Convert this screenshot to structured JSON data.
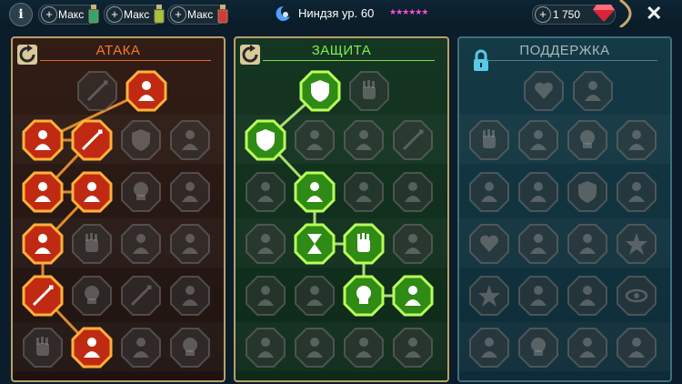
{
  "topbar": {
    "info_icon": "info-icon",
    "boosts": [
      {
        "label": "Макс",
        "icon": "potion-icon",
        "color": "#2fa86a"
      },
      {
        "label": "Макс",
        "icon": "potion-icon",
        "color": "#a6c43a"
      },
      {
        "label": "Макс",
        "icon": "potion-icon",
        "color": "#d43a3a"
      }
    ],
    "hero_name": "Ниндзя ур. 60",
    "hero_icon": "ninja-emblem-icon",
    "stars": "★★★★★★",
    "gems": "1 750",
    "gem_icon": "ruby-icon",
    "close_icon": "close-icon"
  },
  "panels": {
    "attack": {
      "title": "АТАКА",
      "reset_icon": "reset-icon",
      "accent": "#e8632a",
      "nodes": [
        [
          "sword-icon",
          "claws-icon",
          "",
          ""
        ],
        [
          "demon-icon",
          "blades-icon",
          "shield-icon",
          "mask-icon"
        ],
        [
          "hurt-icon",
          "fangs-icon",
          "skull-icon",
          "axe-icon"
        ],
        [
          "blast-icon",
          "fist-icon",
          "hammer-icon",
          "wings-icon"
        ],
        [
          "crossed-sword-icon",
          "skull-icon",
          "spear-icon",
          "warrior-icon"
        ],
        [
          "fist-icon",
          "helm-icon",
          "spirits-icon",
          "skull-icon"
        ]
      ],
      "active": [
        [
          0,
          1
        ],
        [
          1,
          0
        ],
        [
          1,
          1
        ],
        [
          2,
          0
        ],
        [
          2,
          1
        ],
        [
          3,
          0
        ],
        [
          4,
          0
        ],
        [
          5,
          1
        ]
      ]
    },
    "defense": {
      "title": "ЗАЩИТА",
      "reset_icon": "reset-icon",
      "accent": "#7bd83e",
      "nodes": [
        [
          "armor-icon",
          "fist-icon",
          "",
          ""
        ],
        [
          "chest-icon",
          "flame-icon",
          "scroll-icon",
          "sword-icon"
        ],
        [
          "ghost-icon",
          "knight-icon",
          "bloodlust-icon",
          "ogre-icon"
        ],
        [
          "figure-icon",
          "hourglass-icon",
          "hand-icon",
          "face-icon"
        ],
        [
          "running-icon",
          "drops-icon",
          "sun-skull-icon",
          "swap-icon"
        ],
        [
          "mage-icon",
          "hood-icon",
          "mask-icon",
          "monk-icon"
        ]
      ],
      "active": [
        [
          0,
          0
        ],
        [
          1,
          0
        ],
        [
          2,
          1
        ],
        [
          3,
          1
        ],
        [
          3,
          2
        ],
        [
          4,
          2
        ],
        [
          4,
          3
        ]
      ]
    },
    "support": {
      "title": "ПОДДЕРЖКА",
      "lock_icon": "lock-icon",
      "accent": "#4d8d9c",
      "nodes": [
        [
          "heart-icon",
          "ring-icon",
          "",
          ""
        ],
        [
          "hands-icon",
          "aura-icon",
          "skull-icon",
          "arrows-icon"
        ],
        [
          "figure-icon",
          "lightning-icon",
          "shield-icon",
          "stone-icon"
        ],
        [
          "heart-icon",
          "chalice-icon",
          "book-icon",
          "burst-icon"
        ],
        [
          "star-icon",
          "boot-icon",
          "anvil-icon",
          "eye-icon"
        ],
        [
          "bomb-icon",
          "skull-icon",
          "helm-icon",
          "eagle-icon"
        ]
      ],
      "active": []
    }
  }
}
